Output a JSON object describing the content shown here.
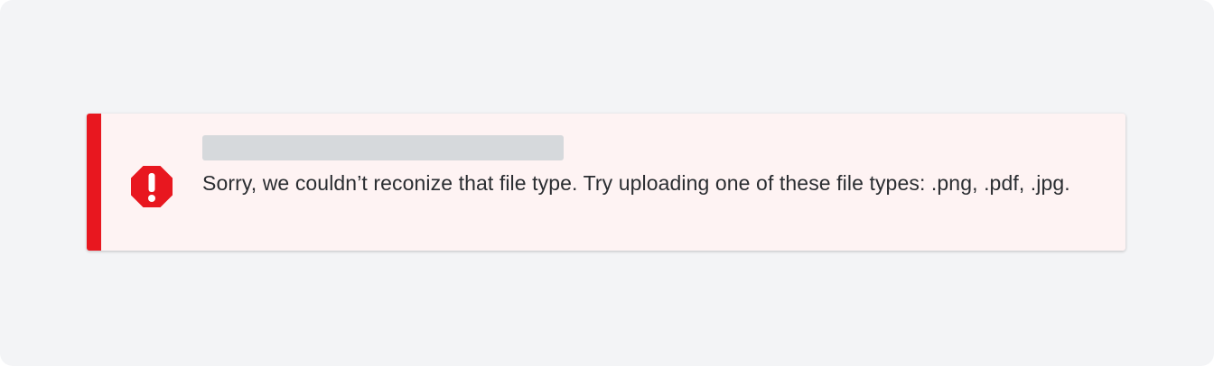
{
  "alert": {
    "type": "error",
    "icon": "error-octagon-icon",
    "message": "Sorry, we couldn’t reconize that file type. Try uploading one of these file types: .png, .pdf, .jpg."
  },
  "colors": {
    "background": "#f3f4f6",
    "alert_background": "#fef3f3",
    "accent": "#e8171f",
    "text": "#2a2d31",
    "placeholder": "#d6d9dc"
  }
}
